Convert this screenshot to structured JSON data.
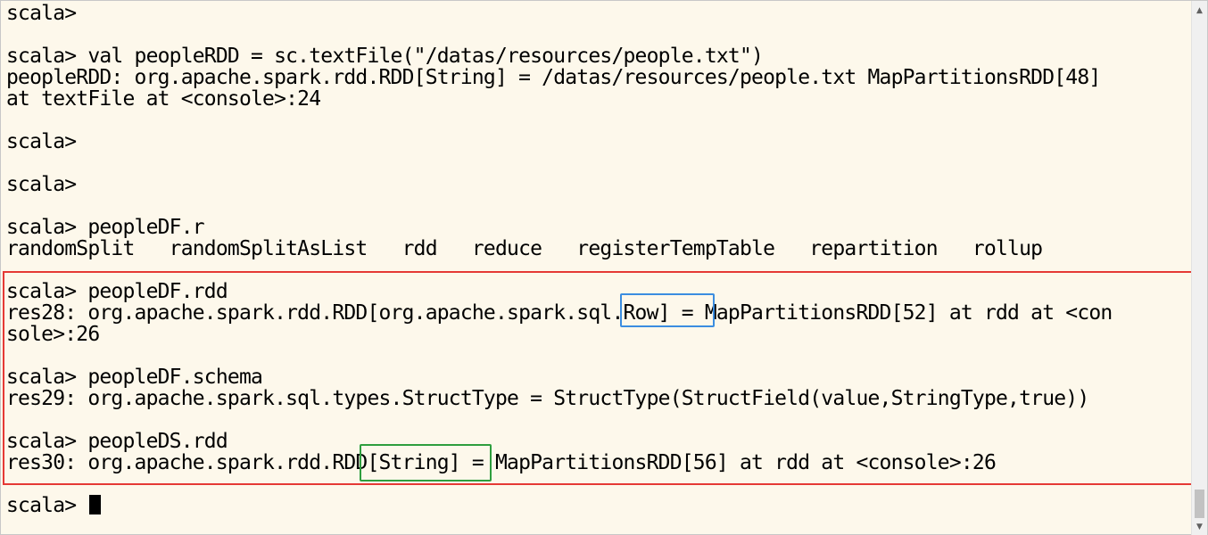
{
  "terminal": {
    "lines": [
      "scala>",
      "",
      "scala> val peopleRDD = sc.textFile(\"/datas/resources/people.txt\")",
      "peopleRDD: org.apache.spark.rdd.RDD[String] = /datas/resources/people.txt MapPartitionsRDD[48]",
      "at textFile at <console>:24",
      "",
      "scala>",
      "",
      "scala>",
      "",
      "scala> peopleDF.r",
      "randomSplit   randomSplitAsList   rdd   reduce   registerTempTable   repartition   rollup",
      "",
      "scala> peopleDF.rdd",
      "res28: org.apache.spark.rdd.RDD[org.apache.spark.sql.Row] = MapPartitionsRDD[52] at rdd at <con",
      "sole>:26",
      "",
      "scala> peopleDF.schema",
      "res29: org.apache.spark.sql.types.StructType = StructType(StructField(value,StringType,true))",
      "",
      "scala> peopleDS.rdd",
      "res30: org.apache.spark.rdd.RDD[String] = MapPartitionsRDD[56] at rdd at <console>:26",
      "",
      "scala> "
    ]
  },
  "annotations": {
    "red_box_color": "#e53935",
    "blue_box_color": "#3b8de0",
    "green_box_color": "#2e9e3e"
  },
  "scrollbar": {
    "up_icon": "triangle-up-icon",
    "down_icon": "triangle-down-icon"
  }
}
